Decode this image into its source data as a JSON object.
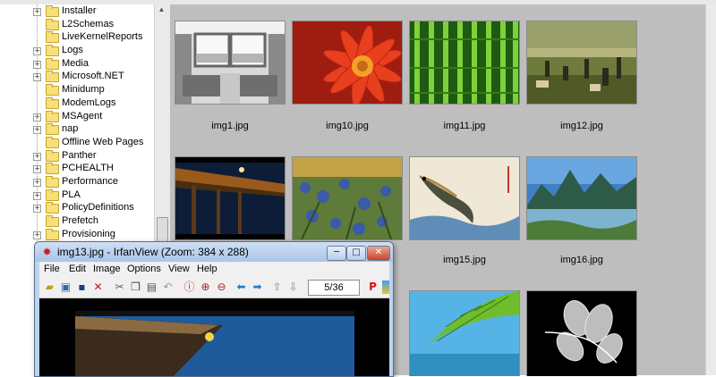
{
  "tree": {
    "items": [
      {
        "label": "Installer",
        "expandable": true
      },
      {
        "label": "L2Schemas",
        "expandable": false
      },
      {
        "label": "LiveKernelReports",
        "expandable": false
      },
      {
        "label": "Logs",
        "expandable": true
      },
      {
        "label": "Media",
        "expandable": true
      },
      {
        "label": "Microsoft.NET",
        "expandable": true
      },
      {
        "label": "Minidump",
        "expandable": false
      },
      {
        "label": "ModemLogs",
        "expandable": false
      },
      {
        "label": "MSAgent",
        "expandable": true
      },
      {
        "label": "nap",
        "expandable": true
      },
      {
        "label": "Offline Web Pages",
        "expandable": false
      },
      {
        "label": "Panther",
        "expandable": true
      },
      {
        "label": "PCHEALTH",
        "expandable": true
      },
      {
        "label": "Performance",
        "expandable": true
      },
      {
        "label": "PLA",
        "expandable": true
      },
      {
        "label": "PolicyDefinitions",
        "expandable": true
      },
      {
        "label": "Prefetch",
        "expandable": false
      },
      {
        "label": "Provisioning",
        "expandable": true
      }
    ]
  },
  "thumbnails": [
    {
      "caption": "img1.jpg"
    },
    {
      "caption": "img10.jpg"
    },
    {
      "caption": "img11.jpg"
    },
    {
      "caption": "img12.jpg"
    },
    {
      "caption": ""
    },
    {
      "caption": ""
    },
    {
      "caption": "img15.jpg"
    },
    {
      "caption": "img16.jpg"
    },
    {
      "caption": ""
    },
    {
      "caption": ""
    },
    {
      "caption": ""
    },
    {
      "caption": ""
    }
  ],
  "viewer": {
    "title": "img13.jpg - IrfanView (Zoom: 384 x 288)",
    "menu": [
      "File",
      "Edit",
      "Image",
      "Options",
      "View",
      "Help"
    ],
    "page_indicator": "5/36"
  }
}
